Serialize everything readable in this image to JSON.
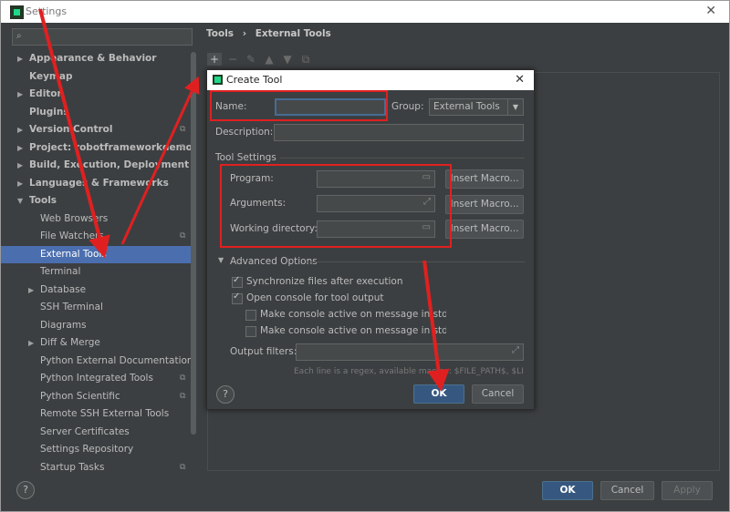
{
  "window": {
    "title": "Settings"
  },
  "sidebar": {
    "search_placeholder": "",
    "items": [
      {
        "label": "Appearance & Behavior",
        "expandable": true,
        "bold": true
      },
      {
        "label": "Keymap",
        "bold": true
      },
      {
        "label": "Editor",
        "expandable": true,
        "bold": true
      },
      {
        "label": "Plugins",
        "bold": true
      },
      {
        "label": "Version Control",
        "expandable": true,
        "bold": true
      },
      {
        "label": "Project: robotframeworkdemo",
        "expandable": true,
        "bold": true
      },
      {
        "label": "Build, Execution, Deployment",
        "expandable": true,
        "bold": true
      },
      {
        "label": "Languages & Frameworks",
        "expandable": true,
        "bold": true
      },
      {
        "label": "Tools",
        "expanded": true,
        "bold": true
      },
      {
        "label": "Web Browsers"
      },
      {
        "label": "File Watchers"
      },
      {
        "label": "External Tools",
        "selected": true
      },
      {
        "label": "Terminal"
      },
      {
        "label": "Database",
        "expandable": true
      },
      {
        "label": "SSH Terminal"
      },
      {
        "label": "Diagrams"
      },
      {
        "label": "Diff & Merge",
        "expandable": true
      },
      {
        "label": "Python External Documentation"
      },
      {
        "label": "Python Integrated Tools"
      },
      {
        "label": "Python Scientific"
      },
      {
        "label": "Remote SSH External Tools"
      },
      {
        "label": "Server Certificates"
      },
      {
        "label": "Settings Repository"
      },
      {
        "label": "Startup Tasks"
      }
    ]
  },
  "breadcrumb": {
    "parent": "Tools",
    "separator": "›",
    "current": "External Tools"
  },
  "footer": {
    "help": "?",
    "ok": "OK",
    "cancel": "Cancel",
    "apply": "Apply"
  },
  "dialog": {
    "title": "Create Tool",
    "name_label": "Name:",
    "name_value": "",
    "group_label": "Group:",
    "group_value": "External Tools",
    "description_label": "Description:",
    "description_value": "",
    "section_tool_settings": "Tool Settings",
    "program_label": "Program:",
    "arguments_label": "Arguments:",
    "working_dir_label": "Working directory:",
    "insert_macro": "Insert Macro...",
    "advanced_label": "Advanced Options",
    "sync_files": "Synchronize files after execution",
    "open_console": "Open console for tool output",
    "console_stdout": "Make console active on message in stdout",
    "console_stderr": "Make console active on message in stderr",
    "output_filters_label": "Output filters:",
    "filters_hint": "Each line is a regex, available macros: $FILE_PATH$, $LINE$ a",
    "help": "?",
    "ok": "OK",
    "cancel": "Cancel",
    "checkboxes": {
      "sync_files": true,
      "open_console": true,
      "console_stdout": false,
      "console_stderr": false
    }
  },
  "colors": {
    "selection": "#4b6eaf",
    "primary_button": "#365880",
    "annotation_red": "#e02020",
    "background": "#3c3f41"
  }
}
